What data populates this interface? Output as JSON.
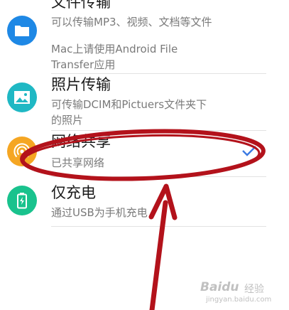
{
  "options": [
    {
      "title": "文件传输",
      "desc_lines": [
        "可以传输MP3、视频、文档等文件",
        "Mac上请使用Android File",
        "Transfer应用"
      ],
      "icon": "folder-icon",
      "color": "#1e88e5"
    },
    {
      "title": "照片传输",
      "desc_lines": [
        "可传输DCIM和Pictuers文件夹下",
        "的照片"
      ],
      "icon": "image-icon",
      "color": "#1fb8c4"
    },
    {
      "title": "网络共享",
      "desc_lines": [
        "已共享网络"
      ],
      "icon": "hotspot-icon",
      "color": "#f5a623",
      "selected": true
    },
    {
      "title": "仅充电",
      "desc_lines": [
        "通过USB为手机充电"
      ],
      "icon": "battery-icon",
      "color": "#19c28d"
    }
  ],
  "colors": {
    "check": "#3d7be3",
    "annotation": "#b3121b"
  },
  "watermark": {
    "brand": "Baidu",
    "suffix": "经验",
    "url": "jingyan.baidu.com"
  }
}
